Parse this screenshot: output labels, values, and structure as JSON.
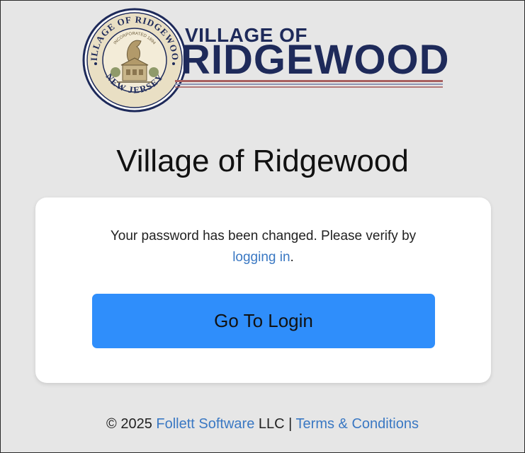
{
  "logo": {
    "line1": "VILLAGE OF",
    "line2": "RIDGEWOOD",
    "seal_top_text": "VILLAGE OF RIDGEWOOD",
    "seal_bottom_text": "NEW JERSEY",
    "seal_inner_text": "INCORPORATED 1894",
    "navy": "#1e2a5a",
    "seal_tan": "#b29a6a"
  },
  "heading": "Village of Ridgewood",
  "card": {
    "message_text": "Your password has been changed. Please verify by ",
    "message_link": "logging in",
    "message_end": ".",
    "button_label": "Go To Login",
    "button_color": "#2f8efb"
  },
  "footer": {
    "copyright": "© 2025 ",
    "company_link": "Follett Software",
    "company_suffix": " LLC | ",
    "terms_link": "Terms & Conditions",
    "link_color": "#3a78c3"
  }
}
